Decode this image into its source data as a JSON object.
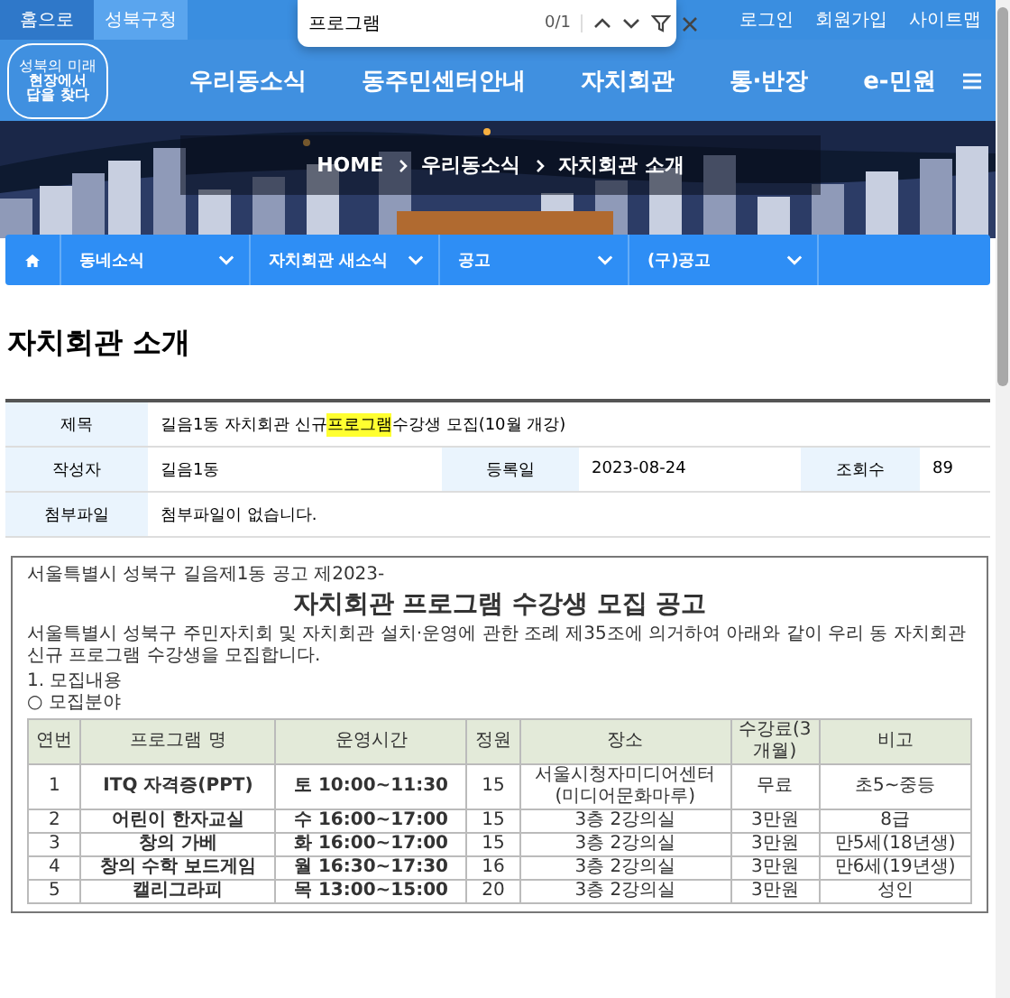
{
  "browser_find": {
    "query": "프로그램",
    "count": "0/1"
  },
  "top_links": [
    {
      "label": "홈으로",
      "kind": "home"
    },
    {
      "label": "성북구청",
      "kind": "site"
    }
  ],
  "user_links": [
    "로그인",
    "회원가입",
    "사이트맵"
  ],
  "logo": {
    "tagline": "성북의 미래",
    "lines": [
      "현장에서",
      "답을 찾다"
    ]
  },
  "main_nav": [
    "우리동소식",
    "동주민센터안내",
    "자치회관",
    "통·반장",
    "e-민원"
  ],
  "breadcrumb": [
    "HOME",
    "우리동소식",
    "자치회관 소개"
  ],
  "sub_nav": [
    "동네소식",
    "자치회관 새소식",
    "공고",
    "(구)공고"
  ],
  "page_title": "자치회관 소개",
  "post": {
    "title_label": "제목",
    "title_before": "길음1동 자치회관 신규 ",
    "title_match": "프로그램",
    "title_after": " 수강생 모집(10월 개강)",
    "author_label": "작성자",
    "author": "길음1동",
    "date_label": "등록일",
    "date": "2023-08-24",
    "views_label": "조회수",
    "views": "89",
    "attach_label": "첨부파일",
    "attach": "첨부파일이 없습니다."
  },
  "document": {
    "notice_no": "서울특별시 성북구 길음제1동 공고 제2023-",
    "heading": "자치회관 프로그램 수강생 모집 공고",
    "intro": "서울특별시 성북구 주민자치회 및 자치회관 설치·운영에 관한 조례 제35조에 의거하여 아래와 같이 우리 동 자치회관 신규 프로그램 수강생을 모집합니다.",
    "section": "1. 모집내용",
    "subsection": "○ 모집분야",
    "columns": [
      "연번",
      "프로그램 명",
      "운영시간",
      "정원",
      "장소",
      "수강료(3개월)",
      "비고"
    ],
    "rows": [
      [
        "1",
        "ITQ 자격증(PPT)",
        "토 10:00~11:30",
        "15",
        "서울시청자미디어센터(미디어문화마루)",
        "무료",
        "초5~중등"
      ],
      [
        "2",
        "어린이 한자교실",
        "수 16:00~17:00",
        "15",
        "3층 2강의실",
        "3만원",
        "8급"
      ],
      [
        "3",
        "창의 가베",
        "화 16:00~17:00",
        "15",
        "3층 2강의실",
        "3만원",
        "만5세(18년생)"
      ],
      [
        "4",
        "창의 수학 보드게임",
        "월 16:30~17:30",
        "16",
        "3층 2강의실",
        "3만원",
        "만6세(19년생)"
      ],
      [
        "5",
        "캘리그라피",
        "목 13:00~15:00",
        "20",
        "3층 2강의실",
        "3만원",
        "성인"
      ]
    ]
  }
}
